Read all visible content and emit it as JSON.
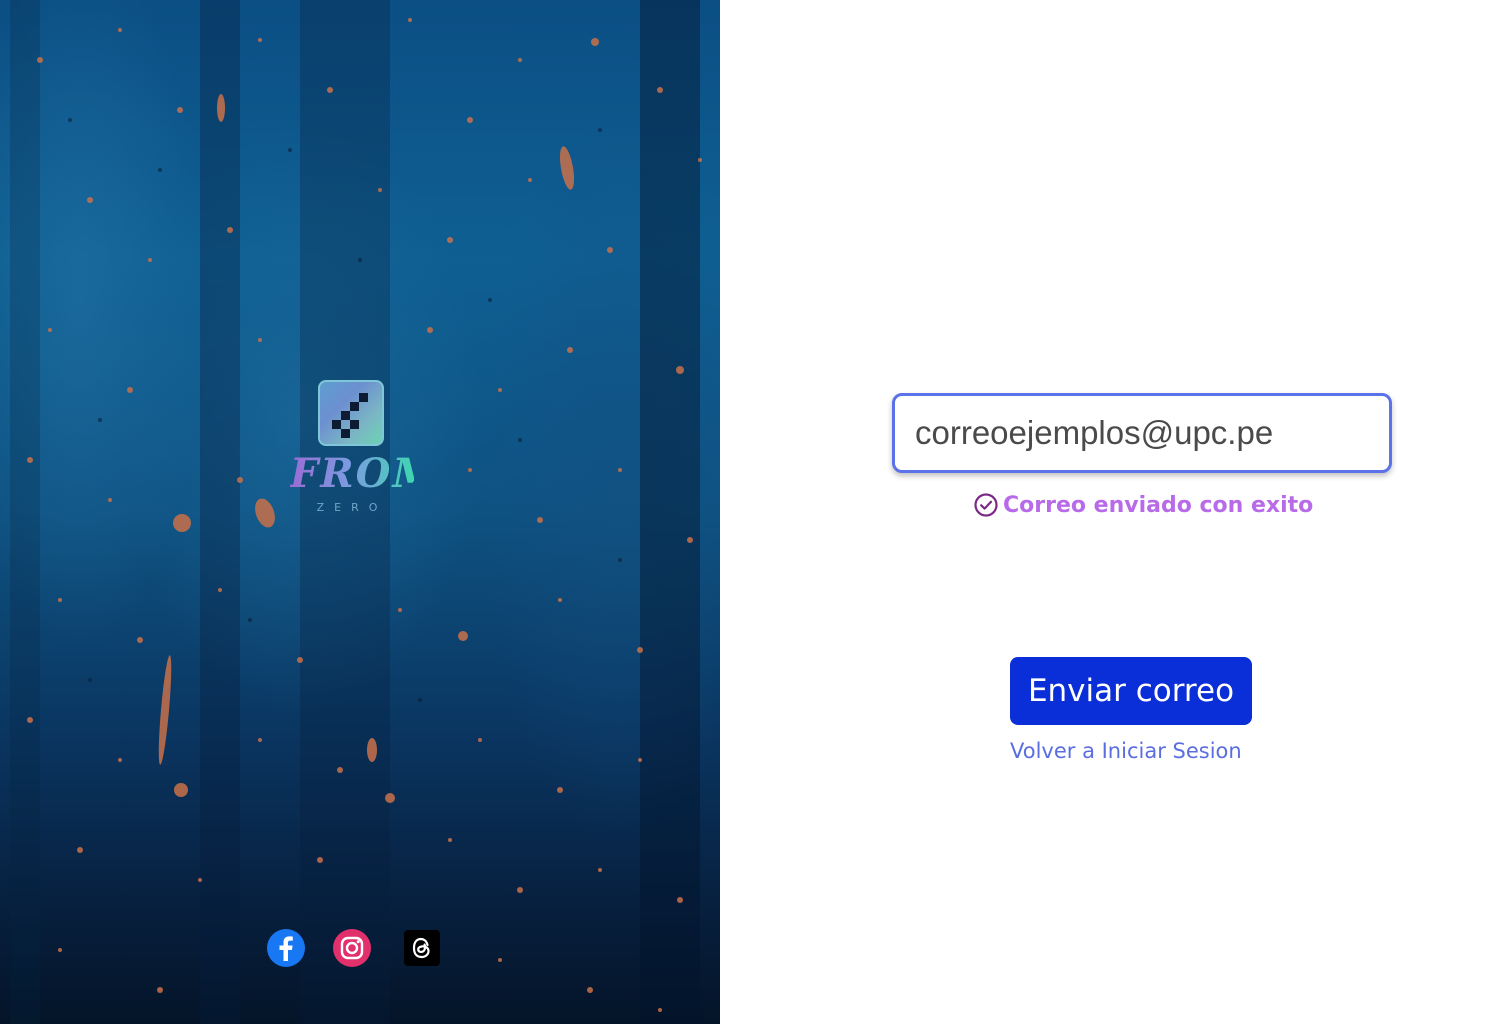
{
  "brand": {
    "logo_text": "FROM",
    "logo_subtext": "ZERO"
  },
  "social": [
    {
      "name": "facebook",
      "icon": "facebook-icon",
      "color": "#1877f2"
    },
    {
      "name": "instagram",
      "icon": "instagram-icon",
      "color": "#e1306c"
    },
    {
      "name": "threads",
      "icon": "threads-icon",
      "color": "#000000"
    }
  ],
  "form": {
    "email_value": "correoejemplos@upc.pe",
    "success_message": "Correo enviado con exito",
    "success_icon": "check-circle-icon",
    "send_button_label": "Enviar correo",
    "back_link_label": "Volver a Iniciar Sesion"
  },
  "colors": {
    "accent": "#0a2ed8",
    "input_border": "#5b72e8",
    "success": "#b86be8",
    "link": "#5a6ee0"
  }
}
